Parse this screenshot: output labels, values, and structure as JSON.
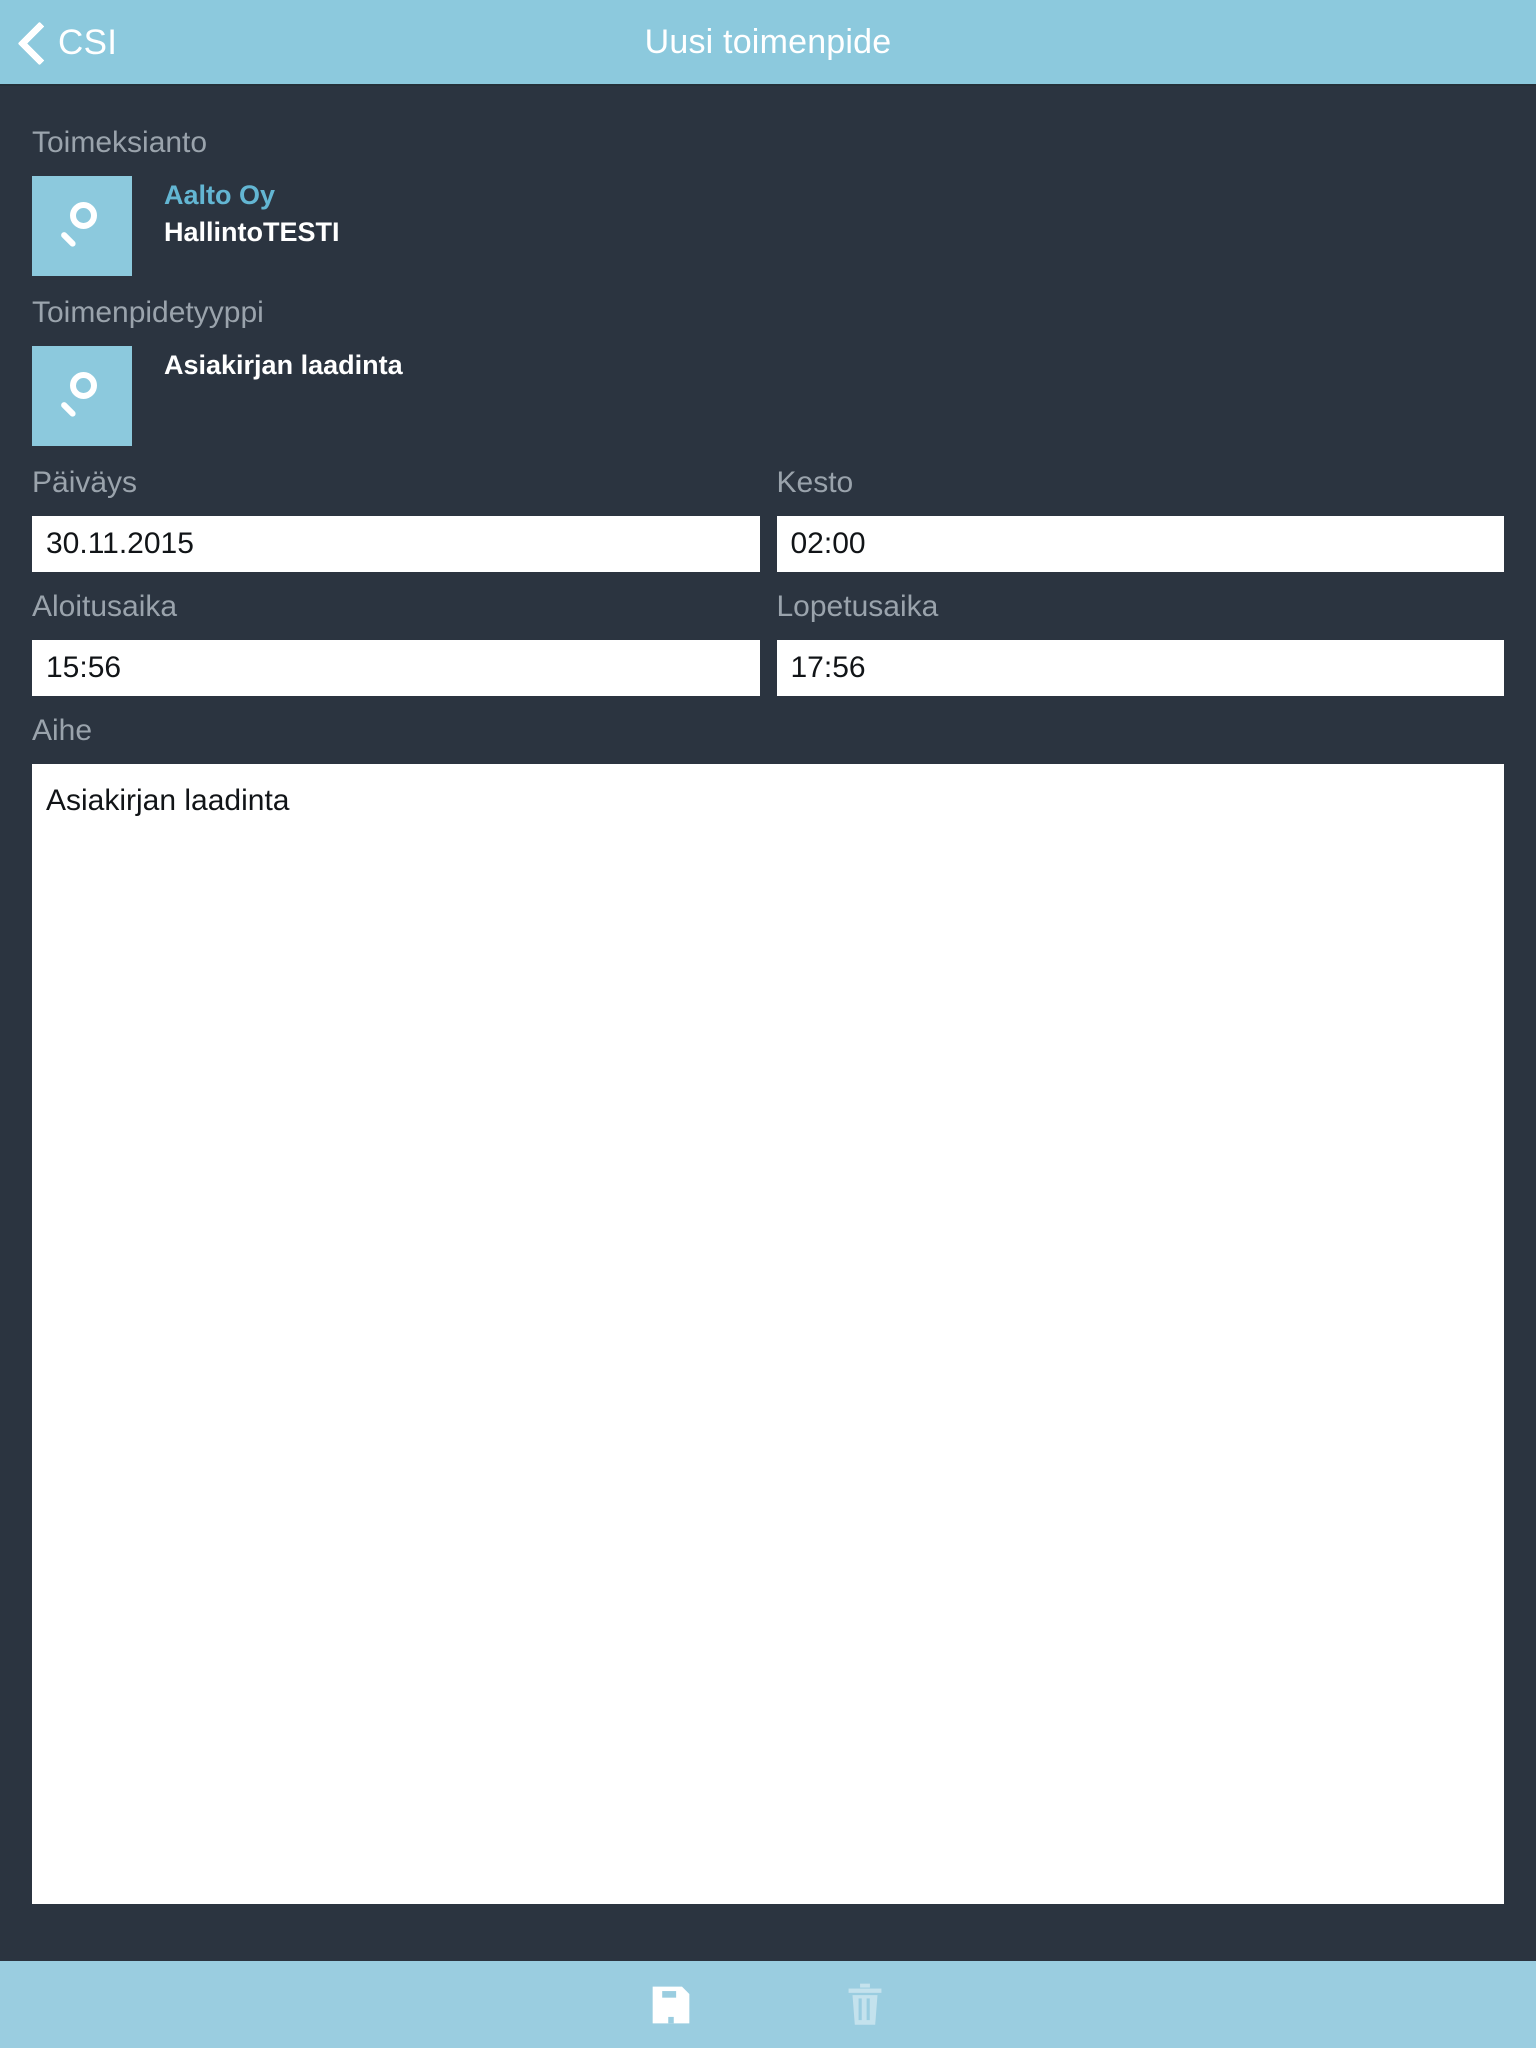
{
  "header": {
    "back_label": "CSI",
    "back_icon": "chevron-left-icon",
    "title": "Uusi toimenpide"
  },
  "form": {
    "assignment": {
      "label": "Toimeksianto",
      "lookup_icon": "search-icon",
      "primary": "Aalto Oy",
      "secondary": "HallintoTESTI"
    },
    "activity_type": {
      "label": "Toimenpidetyyppi",
      "lookup_icon": "search-icon",
      "value": "Asiakirjan laadinta"
    },
    "date": {
      "label": "Päiväys",
      "value": "30.11.2015"
    },
    "duration": {
      "label": "Kesto",
      "value": "02:00"
    },
    "start_time": {
      "label": "Aloitusaika",
      "value": "15:56"
    },
    "end_time": {
      "label": "Lopetusaika",
      "value": "17:56"
    },
    "subject": {
      "label": "Aihe",
      "value": "Asiakirjan laadinta"
    }
  },
  "toolbar": {
    "save_icon": "save-icon",
    "delete_icon": "trash-icon"
  },
  "colors": {
    "accent": "#8cc9dd",
    "toolbar": "#9acde0",
    "background": "#2b3440",
    "label": "#9aa3ac",
    "link": "#63b6d3",
    "field_bg": "#ffffff"
  }
}
